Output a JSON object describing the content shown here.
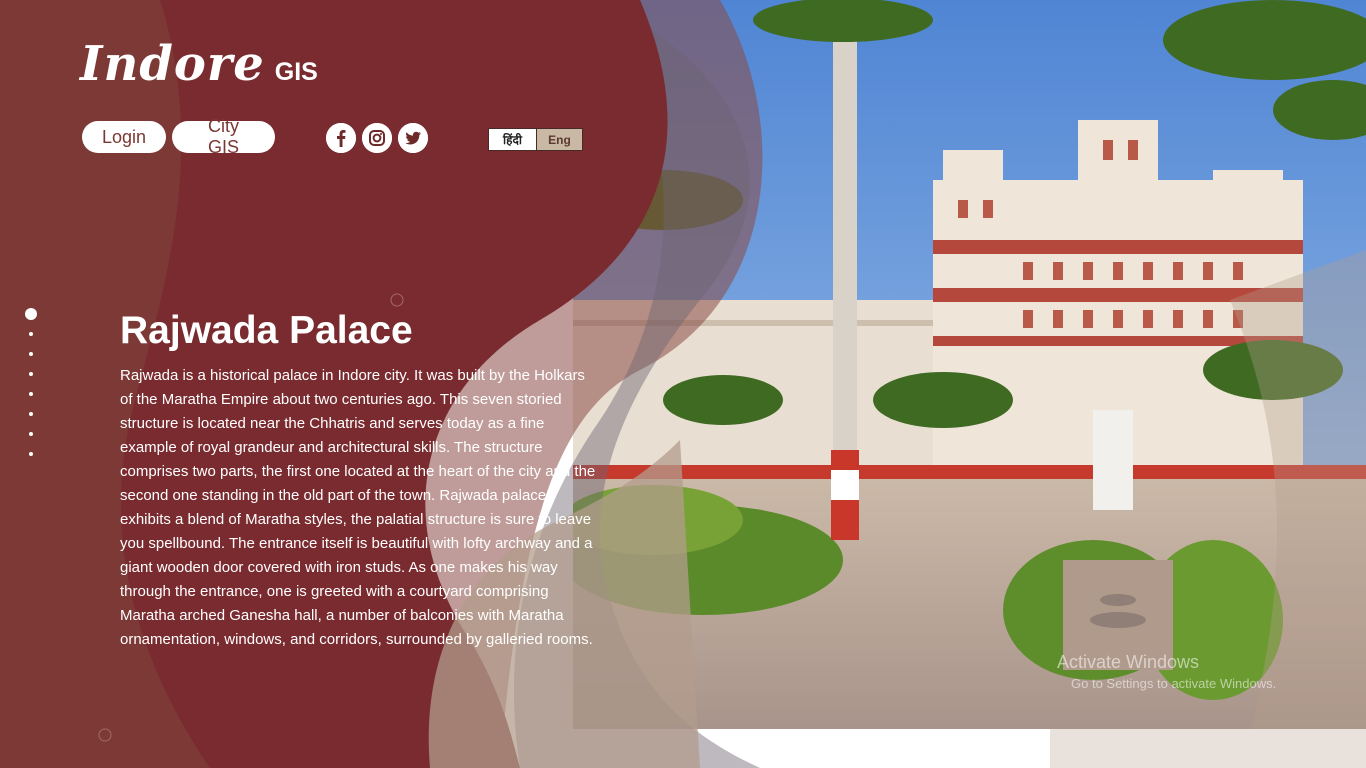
{
  "brand": {
    "logo_script": "Indore",
    "logo_sub": "GIS"
  },
  "nav": {
    "login_label": "Login",
    "city_gis_label": "City GIS"
  },
  "social": {
    "facebook": "f",
    "instagram": "instagram-icon",
    "twitter": "twitter-icon"
  },
  "language": {
    "hindi_label": "हिंदी",
    "english_label": "Eng"
  },
  "slider": {
    "active_index": 0,
    "count": 8
  },
  "content": {
    "title": "Rajwada Palace",
    "description": "Rajwada is a historical palace in Indore city. It was built by the Holkars of the Maratha Empire about two centuries ago. This seven storied structure is located near the Chhatris and serves today as a fine example of royal grandeur and architectural skills. The structure comprises two parts, the first one located at the heart of the city and the second one standing in the old part of the town. Rajwada palace exhibits a blend of Maratha styles, the palatial structure is sure to leave you spellbound. The entrance itself is beautiful with lofty archway and a giant wooden door covered with iron studs. As one makes his way through the entrance, one is greeted with a courtyard comprising Maratha arched Ganesha hall, a number of balconies with Maratha ornamentation, windows, and corridors, surrounded by galleried rooms."
  },
  "watermark": {
    "title": "Activate Windows",
    "subtitle": "Go to Settings to activate Windows."
  },
  "colors": {
    "maroon": "#7a2e2e",
    "brown": "#7d3e36",
    "beige": "#b9a089",
    "sky": "#6f9ad2",
    "accent": "#c0392b"
  }
}
